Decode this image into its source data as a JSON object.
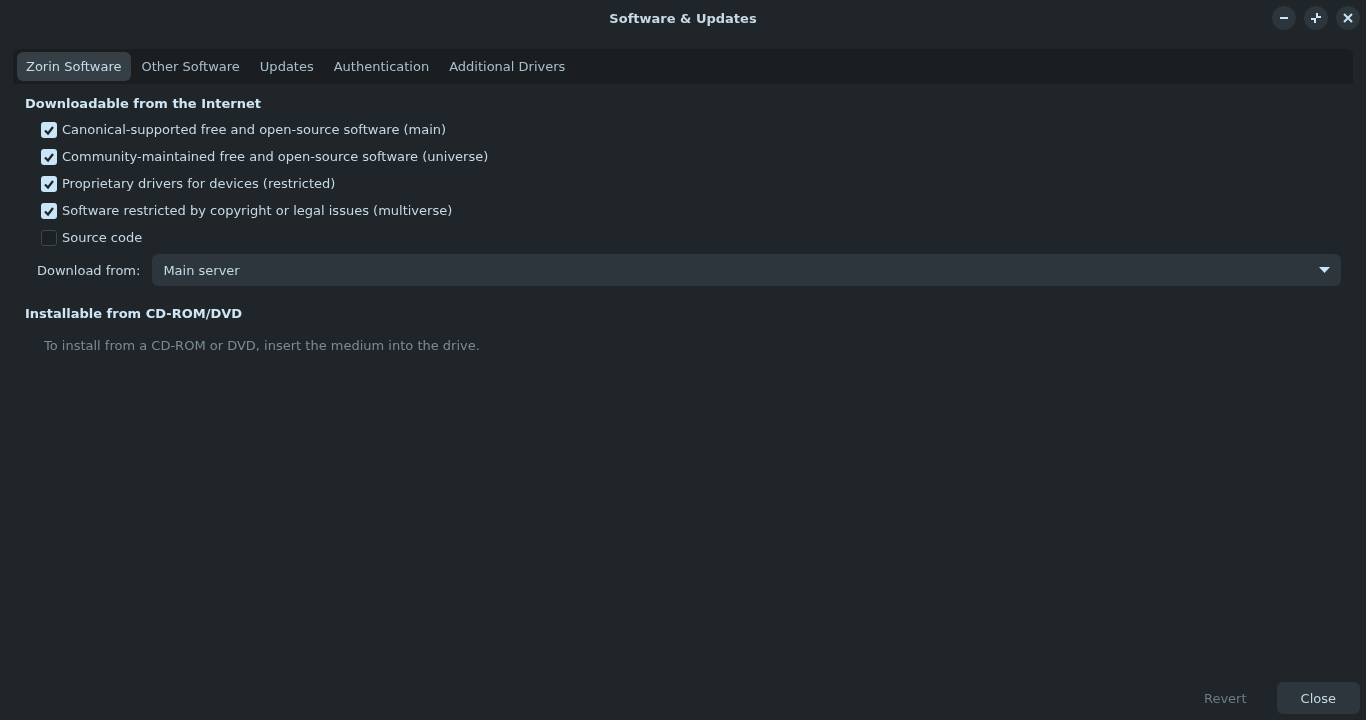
{
  "window": {
    "title": "Software & Updates",
    "controls": [
      {
        "kind": "minimize"
      },
      {
        "kind": "restore"
      },
      {
        "kind": "close"
      }
    ]
  },
  "tabs": [
    {
      "label": "Zorin Software",
      "selected": true
    },
    {
      "label": "Other Software",
      "selected": false
    },
    {
      "label": "Updates",
      "selected": false
    },
    {
      "label": "Authentication",
      "selected": false
    },
    {
      "label": "Additional Drivers",
      "selected": false
    }
  ],
  "internet": {
    "heading": "Downloadable from the Internet",
    "options": [
      {
        "label": "Canonical-supported free and open-source software (main)",
        "checked": true
      },
      {
        "label": "Community-maintained free and open-source software (universe)",
        "checked": true
      },
      {
        "label": "Proprietary drivers for devices (restricted)",
        "checked": true
      },
      {
        "label": "Software restricted by copyright or legal issues (multiverse)",
        "checked": true
      },
      {
        "label": "Source code",
        "checked": false
      }
    ],
    "download_from": {
      "label": "Download from:",
      "value": "Main server"
    }
  },
  "cdrom": {
    "heading": "Installable from CD-ROM/DVD",
    "note": "To install from a CD-ROM or DVD, insert the medium into the drive."
  },
  "buttons": [
    {
      "label": "Revert",
      "disabled": true
    },
    {
      "label": "Close",
      "disabled": false
    }
  ]
}
